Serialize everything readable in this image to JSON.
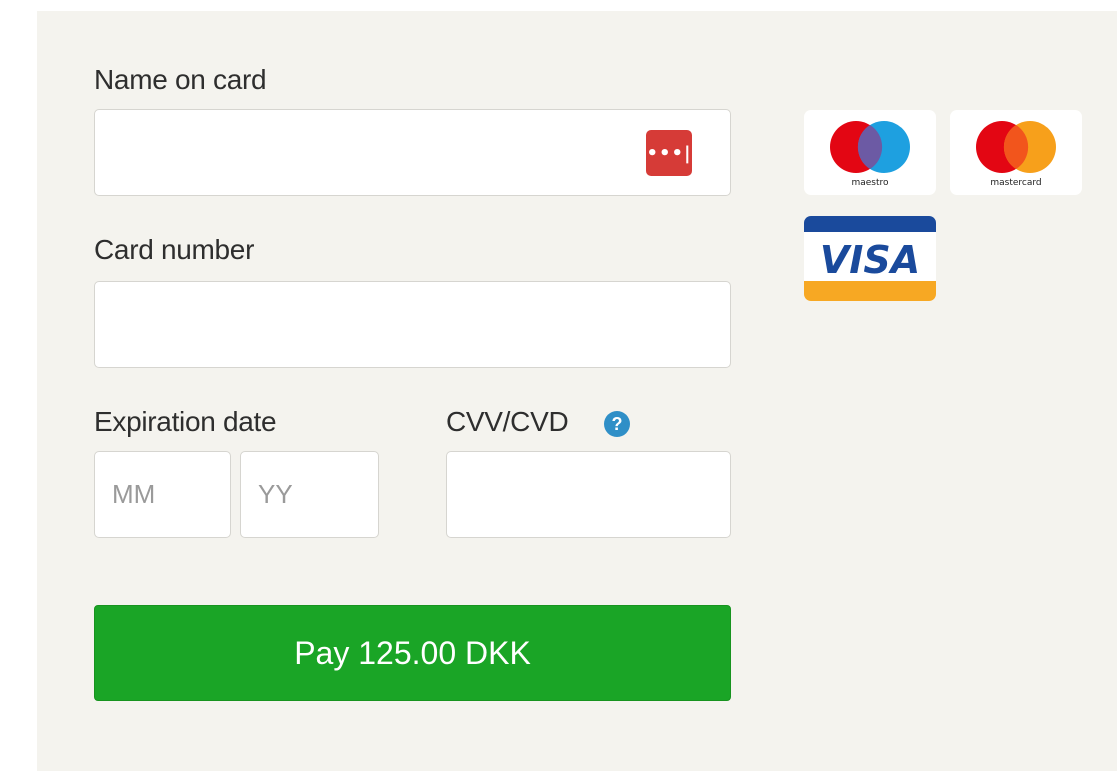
{
  "form": {
    "name_label": "Name on card",
    "name_value": "",
    "number_label": "Card number",
    "number_value": "",
    "expiry_label": "Expiration date",
    "month_placeholder": "MM",
    "year_placeholder": "YY",
    "cvv_label": "CVV/CVD",
    "cvv_value": "",
    "help_icon": "question-circle-icon",
    "password_manager_icon": "password-manager-icon",
    "password_manager_glyph": "•••|"
  },
  "pay_button": {
    "label": "Pay 125.00 DKK",
    "color": "#1aa526"
  },
  "card_brands": {
    "maestro": "maestro",
    "mastercard": "mastercard",
    "visa": "VISA"
  },
  "colors": {
    "panel_bg": "#f4f3ee",
    "password_icon_bg": "#d63b37",
    "help_icon_bg": "#2f8fc7",
    "visa_blue": "#1a4a9c",
    "visa_gold": "#f7a823"
  }
}
